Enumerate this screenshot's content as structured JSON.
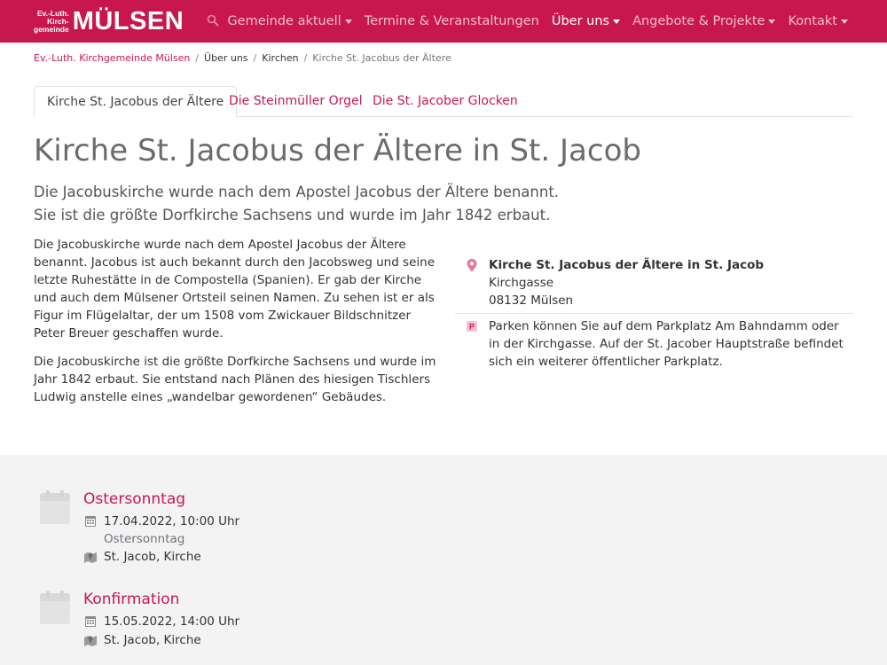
{
  "header": {
    "logo_small_lines": [
      "Ev.-Luth.",
      "Kirch-",
      "gemeinde"
    ],
    "logo_big": "MÜLSEN",
    "nav": [
      {
        "label": "Gemeinde aktuell",
        "dropdown": true,
        "active": false
      },
      {
        "label": "Termine & Veranstaltungen",
        "dropdown": false,
        "active": false
      },
      {
        "label": "Über uns",
        "dropdown": true,
        "active": true
      },
      {
        "label": "Angebote & Projekte",
        "dropdown": true,
        "active": false
      },
      {
        "label": "Kontakt",
        "dropdown": true,
        "active": false
      }
    ],
    "brand_color": "#c8174f"
  },
  "breadcrumb": {
    "home": "Ev.-Luth. Kirchgemeinde Mülsen",
    "level1": "Über uns",
    "level2": "Kirchen",
    "current": "Kirche St. Jacobus der Ältere"
  },
  "tabs": [
    {
      "label": "Kirche St. Jacobus der Ältere",
      "active": true
    },
    {
      "label": "Die Steinmüller Orgel",
      "active": false
    },
    {
      "label": "Die St. Jacober Glocken",
      "active": false
    }
  ],
  "main": {
    "title": "Kirche St. Jacobus der Ältere in St. Jacob",
    "lead": "Die Jacobuskirche wurde nach dem Apostel Jacobus der Ältere benannt. Sie ist die größte Dorfkirche Sachsens und wurde im Jahr 1842 erbaut.",
    "paragraphs": [
      "Die Jacobuskirche wurde nach dem Apostel Jacobus der Ältere benannt. Jacobus ist auch bekannt durch den Jacobsweg und seine letzte Ruhestätte in de Compostella (Spanien). Er gab der Kirche und auch dem Mülsener Ortsteil seinen Namen. Zu sehen ist er als Figur im Flügelaltar, der um 1508 vom Zwickauer Bildschnitzer Peter Breuer geschaffen wurde.",
      "Die Jacobuskirche ist die größte Dorfkirche Sachsens und wurde im Jahr 1842 erbaut. Sie entstand nach Plänen des hiesigen Tischlers Ludwig anstelle eines „wandelbar gewordenen“ Gebäudes."
    ]
  },
  "info": {
    "address_title": "Kirche St. Jacobus der Ältere in St. Jacob",
    "street": "Kirchgasse",
    "city": "08132 Mülsen",
    "parking_icon_letter": "P",
    "parking": "Parken können Sie auf dem Parkplatz Am Bahndamm oder in der Kirchgasse. Auf der St. Jacober Hauptstraße befindet sich ein weiterer öffentlicher Parkplatz."
  },
  "events": [
    {
      "title": "Ostersonntag",
      "datetime": "17.04.2022, 10:00 Uhr",
      "subtitle": "Ostersonntag",
      "location": "St. Jacob, Kirche"
    },
    {
      "title": "Konfirmation",
      "datetime": "15.05.2022, 14:00 Uhr",
      "location": "St. Jacob, Kirche"
    }
  ]
}
